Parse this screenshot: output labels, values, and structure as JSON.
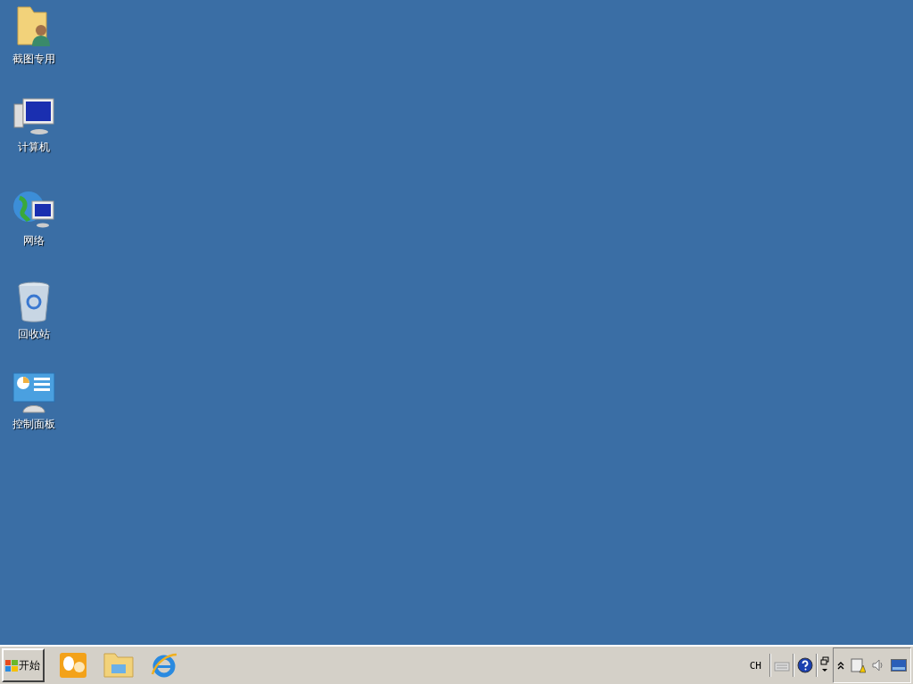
{
  "desktop_icons": [
    {
      "kind": "user-folder",
      "label": "截图专用"
    },
    {
      "kind": "computer",
      "label": "计算机"
    },
    {
      "kind": "network",
      "label": "网络"
    },
    {
      "kind": "recycle-bin",
      "label": "回收站"
    },
    {
      "kind": "control-panel",
      "label": "控制面板"
    }
  ],
  "taskbar": {
    "start_button": "开始",
    "quick_launch": [
      {
        "kind": "mail"
      },
      {
        "kind": "folder"
      },
      {
        "kind": "browser"
      }
    ],
    "language": "CH",
    "tray_icons": [
      {
        "kind": "keyboard"
      },
      {
        "kind": "help"
      },
      {
        "kind": "restore"
      }
    ],
    "notification_icons": [
      {
        "kind": "chevron"
      },
      {
        "kind": "network-warning"
      },
      {
        "kind": "speaker"
      },
      {
        "kind": "desktop"
      }
    ]
  }
}
